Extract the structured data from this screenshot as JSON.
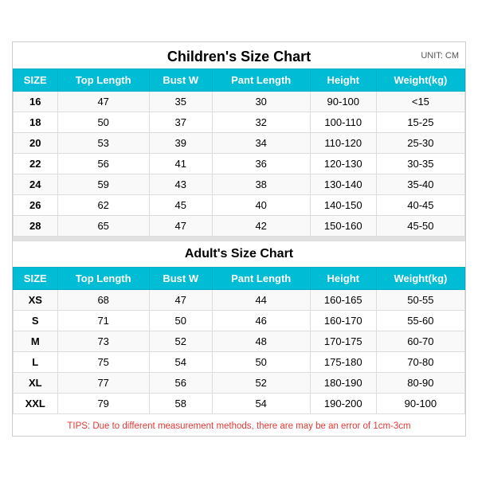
{
  "title": "Children's Size Chart",
  "unit": "UNIT: CM",
  "children": {
    "headers": [
      "SIZE",
      "Top Length",
      "Bust W",
      "Pant Length",
      "Height",
      "Weight(kg)"
    ],
    "rows": [
      [
        "16",
        "47",
        "35",
        "30",
        "90-100",
        "<15"
      ],
      [
        "18",
        "50",
        "37",
        "32",
        "100-110",
        "15-25"
      ],
      [
        "20",
        "53",
        "39",
        "34",
        "110-120",
        "25-30"
      ],
      [
        "22",
        "56",
        "41",
        "36",
        "120-130",
        "30-35"
      ],
      [
        "24",
        "59",
        "43",
        "38",
        "130-140",
        "35-40"
      ],
      [
        "26",
        "62",
        "45",
        "40",
        "140-150",
        "40-45"
      ],
      [
        "28",
        "65",
        "47",
        "42",
        "150-160",
        "45-50"
      ]
    ]
  },
  "adult_title": "Adult's Size Chart",
  "adult": {
    "headers": [
      "SIZE",
      "Top Length",
      "Bust W",
      "Pant Length",
      "Height",
      "Weight(kg)"
    ],
    "rows": [
      [
        "XS",
        "68",
        "47",
        "44",
        "160-165",
        "50-55"
      ],
      [
        "S",
        "71",
        "50",
        "46",
        "160-170",
        "55-60"
      ],
      [
        "M",
        "73",
        "52",
        "48",
        "170-175",
        "60-70"
      ],
      [
        "L",
        "75",
        "54",
        "50",
        "175-180",
        "70-80"
      ],
      [
        "XL",
        "77",
        "56",
        "52",
        "180-190",
        "80-90"
      ],
      [
        "XXL",
        "79",
        "58",
        "54",
        "190-200",
        "90-100"
      ]
    ]
  },
  "tips": "TIPS: Due to different measurement methods, there are may be an error of 1cm-3cm"
}
